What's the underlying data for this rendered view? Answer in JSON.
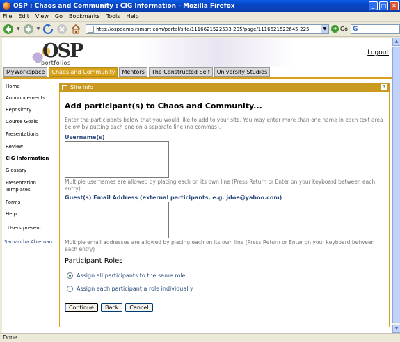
{
  "window": {
    "title": "OSP : Chaos and Community : CIG Information - Mozilla Firefox",
    "minimize": "_",
    "maximize": "□",
    "close": "✕"
  },
  "menubar": [
    "File",
    "Edit",
    "View",
    "Go",
    "Bookmarks",
    "Tools",
    "Help"
  ],
  "navbar": {
    "url": "http://ospdemo.rsmart.com/portal/site/1116621522533-205/page/1116621522645-225",
    "go_label": "Go",
    "search_glyph": "G",
    "icons": [
      "back-icon",
      "forward-icon",
      "reload-icon",
      "stop-icon",
      "home-icon"
    ]
  },
  "header": {
    "logo_text": "OSP",
    "logo_sub": "portfolios",
    "logout": "Logout"
  },
  "tabs": [
    {
      "label": "MyWorkspace",
      "active": false
    },
    {
      "label": "Chaos and Community",
      "active": true
    },
    {
      "label": "Mentors",
      "active": false
    },
    {
      "label": "The Constructed Self",
      "active": false
    },
    {
      "label": "University Studies",
      "active": false
    }
  ],
  "sidebar": {
    "items": [
      {
        "label": "Home"
      },
      {
        "label": "Announcements"
      },
      {
        "label": "Repository"
      },
      {
        "label": "Course Goals"
      },
      {
        "label": "Presentations"
      },
      {
        "label": "Review"
      },
      {
        "label": "CIG Information"
      },
      {
        "label": "Glossary"
      },
      {
        "label": "Presentation"
      },
      {
        "label": "Templates"
      },
      {
        "label": "Forms"
      },
      {
        "label": "Help"
      }
    ],
    "users_present": "Users present:",
    "person": "Samantha Ableman"
  },
  "panel": {
    "title": "Site Info",
    "help": "?"
  },
  "form": {
    "heading": "Add participant(s) to Chaos and Community...",
    "instructions": "Enter the participants below that you would like to add to your site. You may enter more than one name in each text area below by putting each one on a separate line (no commas).",
    "usernames_label": "Username(s)",
    "usernames_value": "",
    "usernames_note": "Multiple usernames are allowed by placing each on its own line (Press Return or Enter on your keyboard between each entry)",
    "guest_label": "Guest(s) Email Address (external participants, e.g. jdoe@yahoo.com)",
    "guest_value": "",
    "guest_note": "Multiple email addresses are allowed by placing each on its own line (Press Return or Enter on your keyboard between each entry)",
    "roles_heading": "Participant Roles",
    "role_options": [
      {
        "label": "Assign all participants to the same role",
        "checked": true
      },
      {
        "label": "Assign each participant a role individually",
        "checked": false
      }
    ],
    "buttons": {
      "continue": "Continue",
      "back": "Back",
      "cancel": "Cancel"
    }
  },
  "status": "Done",
  "colors": {
    "accent": "#d6a21c",
    "titlebar": "#0a5ce8",
    "label": "#2b4a7a"
  }
}
